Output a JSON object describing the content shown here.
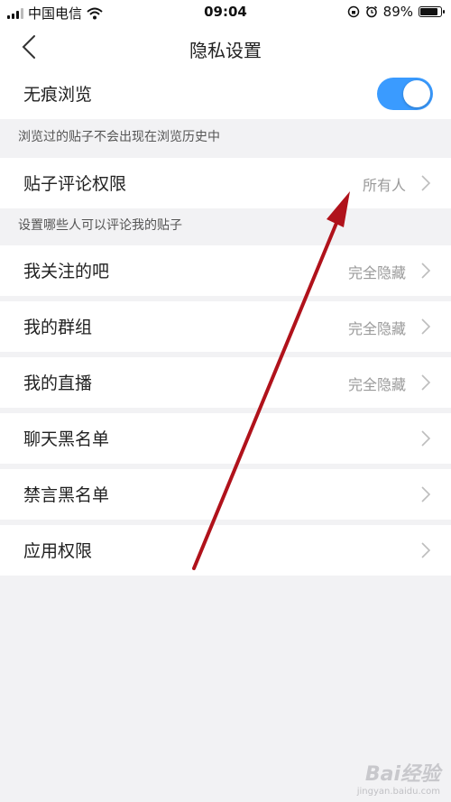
{
  "status_bar": {
    "carrier": "中国电信",
    "time": "09:04",
    "battery": "89%",
    "battery_level": 0.89
  },
  "nav": {
    "title": "隐私设置"
  },
  "incognito": {
    "label": "无痕浏览",
    "enabled": true,
    "hint": "浏览过的贴子不会出现在浏览历史中"
  },
  "comment_permission": {
    "label": "贴子评论权限",
    "value": "所有人",
    "hint": "设置哪些人可以评论我的贴子"
  },
  "settings": [
    {
      "label": "我关注的吧",
      "value": "完全隐藏"
    },
    {
      "label": "我的群组",
      "value": "完全隐藏"
    },
    {
      "label": "我的直播",
      "value": "完全隐藏"
    },
    {
      "label": "聊天黑名单",
      "value": ""
    },
    {
      "label": "禁言黑名单",
      "value": ""
    },
    {
      "label": "应用权限",
      "value": ""
    }
  ],
  "colors": {
    "toggle_on": "#3a9bff",
    "annotation_arrow": "#b0121b",
    "background": "#f2f2f4"
  },
  "watermark": {
    "logo": "Bai经验",
    "url": "jingyan.baidu.com"
  }
}
